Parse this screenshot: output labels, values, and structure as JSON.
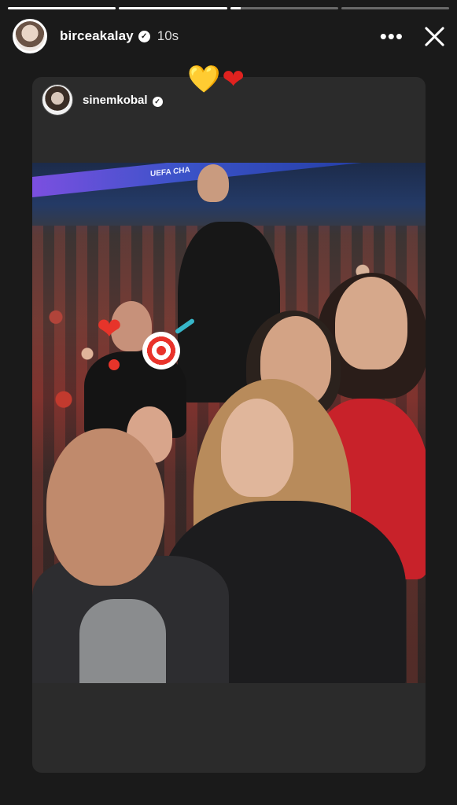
{
  "story": {
    "progress_segments": [
      1,
      1,
      0.1,
      0
    ],
    "username": "birceakalay",
    "time_ago": "10s",
    "more_label": "•••"
  },
  "repost": {
    "username": "sinemkobal",
    "photo_banner_text": "UEFA CHA"
  },
  "stickers": {
    "top_hearts": [
      "💛",
      "❤"
    ],
    "photo_heart": "❤"
  },
  "colors": {
    "background": "#1a1a1a",
    "card": "#2b2b2b",
    "verified_badge": "#ffffff"
  }
}
